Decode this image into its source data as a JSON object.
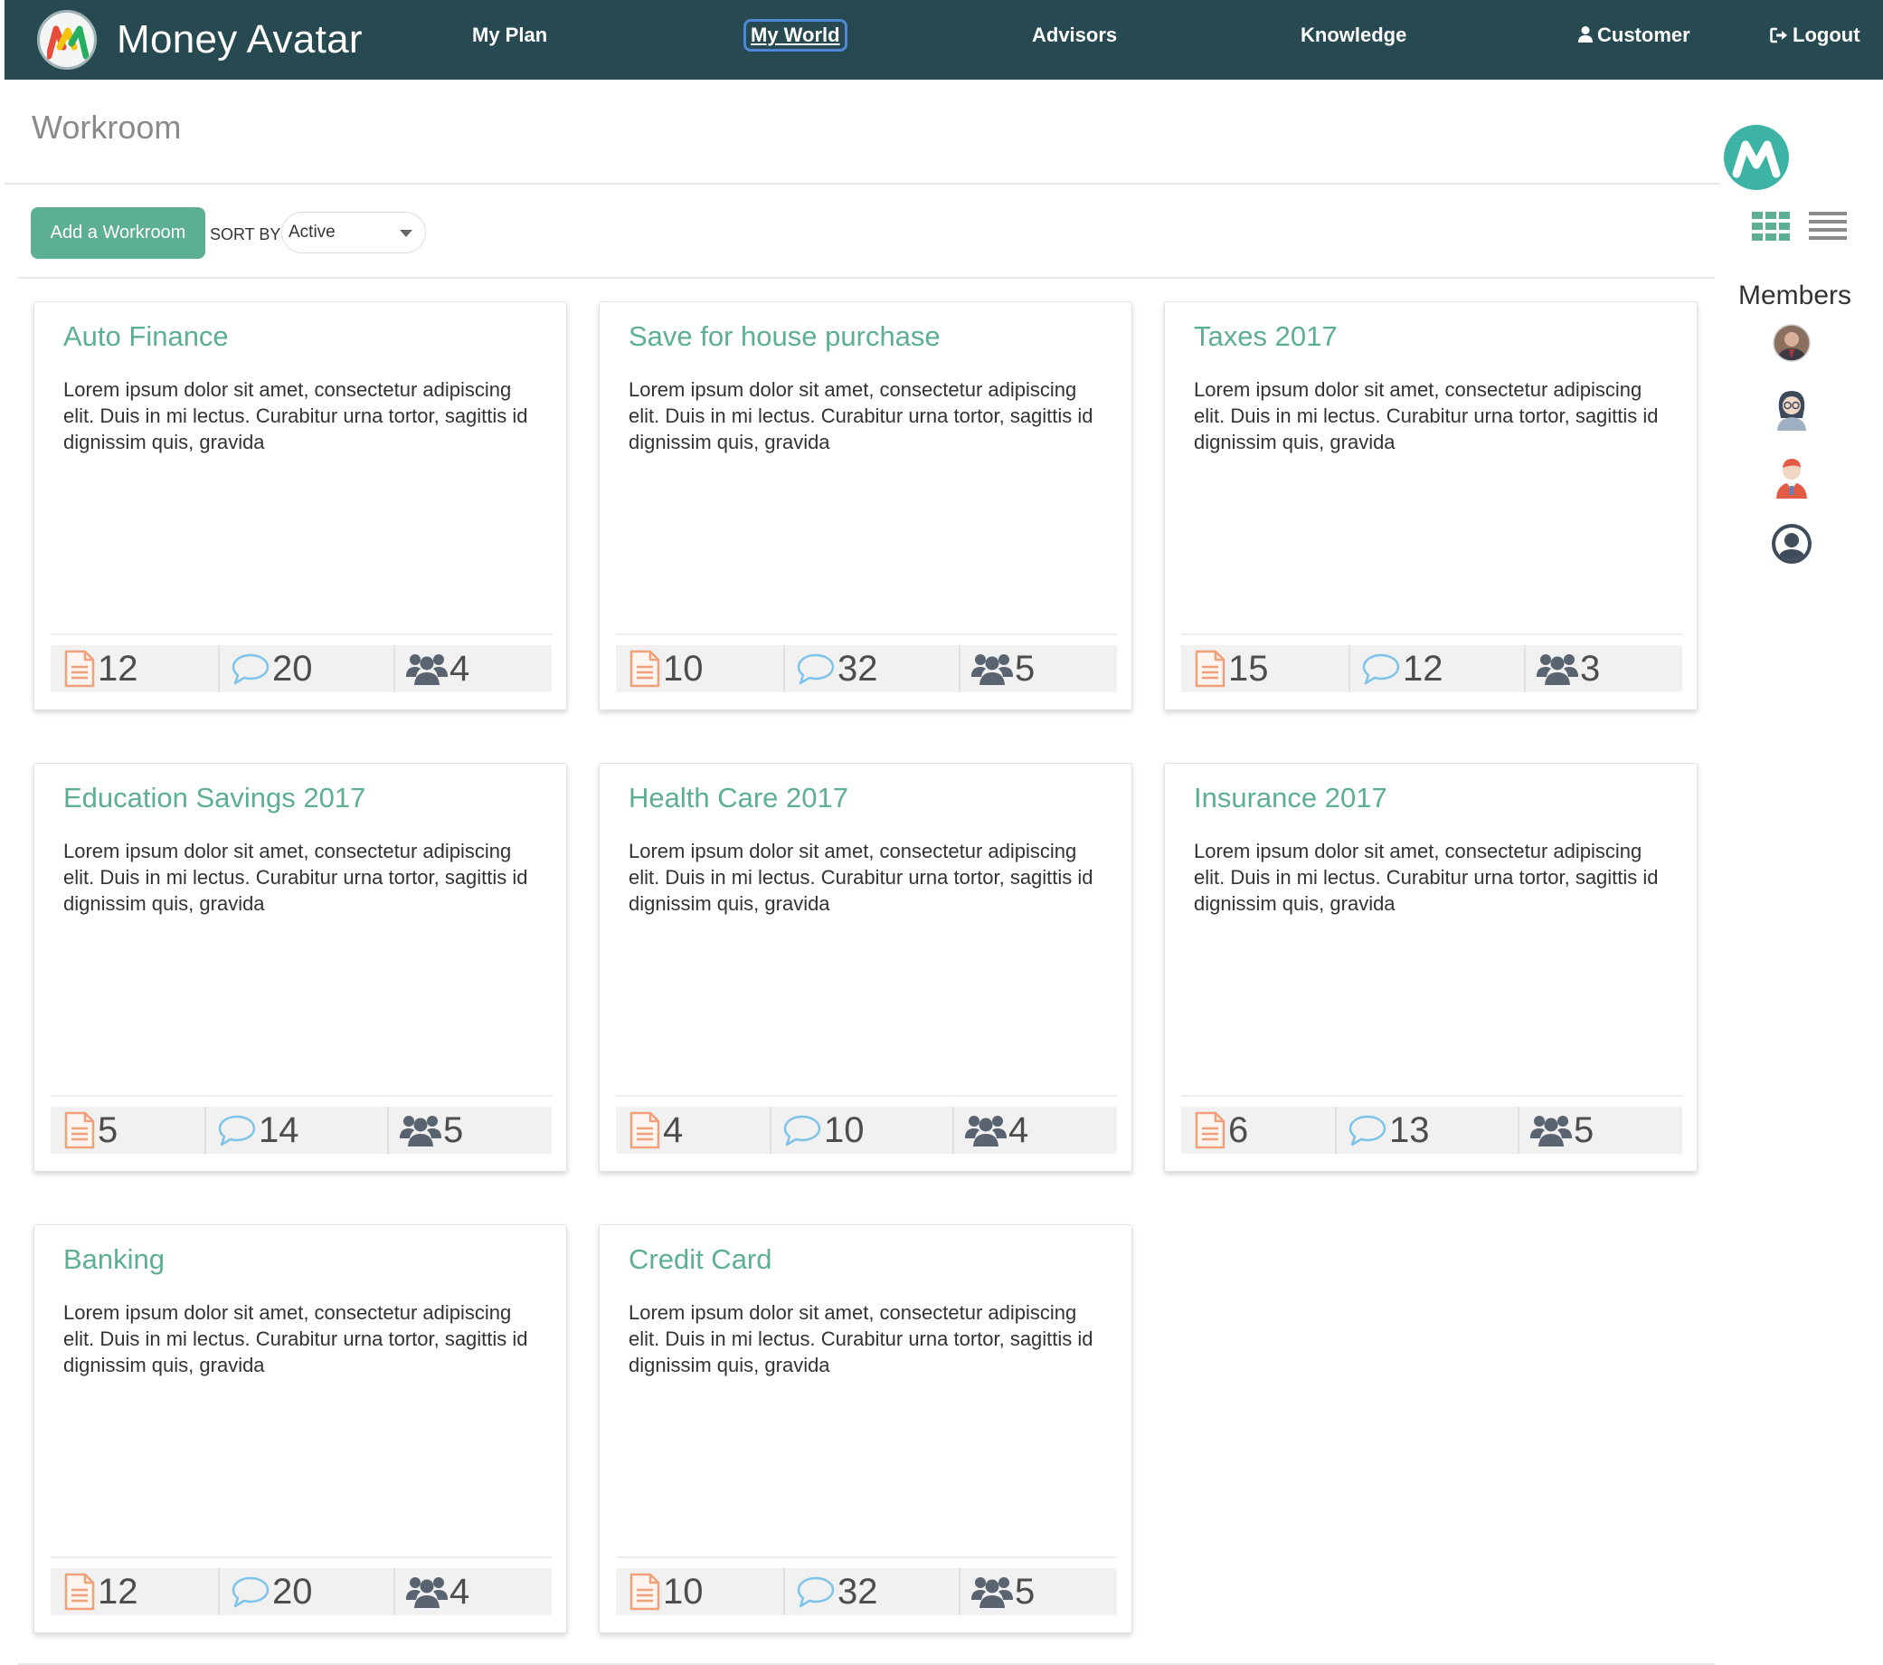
{
  "app": {
    "brand": "Money Avatar"
  },
  "nav": {
    "items": [
      {
        "label": "My Plan"
      },
      {
        "label": "My World",
        "active": true
      },
      {
        "label": "Advisors"
      },
      {
        "label": "Knowledge"
      }
    ],
    "customer_label": "Customer",
    "logout_label": "Logout"
  },
  "page": {
    "title": "Workroom"
  },
  "toolbar": {
    "add_label": "Add a Workroom",
    "sort_label": "SORT BY",
    "sort_value": "Active"
  },
  "colors": {
    "navbar": "#274a52",
    "accent": "#5caf91",
    "document_icon": "#f0a07a",
    "comment_icon": "#7ec3ea",
    "group_icon": "#5a6470"
  },
  "cards": [
    {
      "title": "Auto Finance",
      "description": "Lorem ipsum dolor sit amet, consectetur adipiscing elit. Duis in mi lectus. Curabitur urna tortor, sagittis id dignissim quis, gravida",
      "documents": "12",
      "comments": "20",
      "members": "4"
    },
    {
      "title": "Save for house purchase",
      "description": "Lorem ipsum dolor sit amet, consectetur adipiscing elit. Duis in mi lectus. Curabitur urna tortor, sagittis id dignissim quis, gravida",
      "documents": "10",
      "comments": "32",
      "members": "5"
    },
    {
      "title": "Taxes 2017",
      "description": "Lorem ipsum dolor sit amet, consectetur adipiscing elit. Duis in mi lectus. Curabitur urna tortor, sagittis id dignissim quis, gravida",
      "documents": "15",
      "comments": "12",
      "members": "3"
    },
    {
      "title": "Education Savings 2017",
      "description": "Lorem ipsum dolor sit amet, consectetur adipiscing elit. Duis in mi lectus. Curabitur urna tortor, sagittis id dignissim quis, gravida",
      "documents": "5",
      "comments": "14",
      "members": "5"
    },
    {
      "title": "Health Care 2017",
      "description": "Lorem ipsum dolor sit amet, consectetur adipiscing elit. Duis in mi lectus. Curabitur urna tortor, sagittis id dignissim quis, gravida",
      "documents": "4",
      "comments": "10",
      "members": "4"
    },
    {
      "title": "Insurance 2017",
      "description": "Lorem ipsum dolor sit amet, consectetur adipiscing elit. Duis in mi lectus. Curabitur urna tortor, sagittis id dignissim quis, gravida",
      "documents": "6",
      "comments": "13",
      "members": "5"
    },
    {
      "title": "Banking",
      "description": "Lorem ipsum dolor sit amet, consectetur adipiscing elit. Duis in mi lectus. Curabitur urna tortor, sagittis id dignissim quis, gravida",
      "documents": "12",
      "comments": "20",
      "members": "4"
    },
    {
      "title": "Credit Card",
      "description": "Lorem ipsum dolor sit amet, consectetur adipiscing elit. Duis in mi lectus. Curabitur urna tortor, sagittis id dignissim quis, gravida",
      "documents": "10",
      "comments": "32",
      "members": "5"
    }
  ],
  "sidebar": {
    "members_title": "Members",
    "view_icons": [
      "grid-view-icon",
      "list-view-icon"
    ],
    "members": [
      {
        "icon": "member-photo-avatar"
      },
      {
        "icon": "member-woman-glasses-avatar"
      },
      {
        "icon": "member-man-red-hair-avatar"
      },
      {
        "icon": "member-placeholder-avatar"
      }
    ]
  }
}
